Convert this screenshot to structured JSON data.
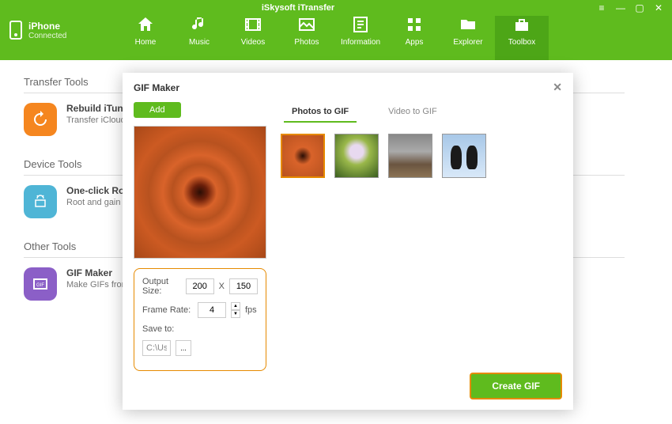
{
  "app_title": "iSkysoft iTransfer",
  "device": {
    "name": "iPhone",
    "status": "Connected"
  },
  "nav": [
    {
      "label": "Home"
    },
    {
      "label": "Music"
    },
    {
      "label": "Videos"
    },
    {
      "label": "Photos"
    },
    {
      "label": "Information"
    },
    {
      "label": "Apps"
    },
    {
      "label": "Explorer"
    },
    {
      "label": "Toolbox"
    }
  ],
  "sections": {
    "transfer": {
      "title": "Transfer Tools",
      "item": {
        "title": "Rebuild iTunes Library",
        "desc": "Transfer iCloud backup data and Playlists to any other device"
      }
    },
    "device": {
      "title": "Device Tools",
      "item": {
        "title": "One-click Root",
        "desc": "Root and gain full control of your Android device"
      }
    },
    "other": {
      "title": "Other Tools",
      "item": {
        "title": "GIF Maker",
        "desc": "Make GIFs from photos or video"
      }
    }
  },
  "modal": {
    "title": "GIF Maker",
    "add_label": "Add",
    "tabs": {
      "photos": "Photos to GIF",
      "video": "Video to GIF"
    },
    "settings": {
      "output_label": "Output Size:",
      "width": "200",
      "sep": "X",
      "height": "150",
      "frame_label": "Frame Rate:",
      "frame_rate": "4",
      "fps": "fps",
      "save_label": "Save to:",
      "save_path": "C:\\Users\\ws\\Pictures\\iSkysoft iTr...",
      "browse": "..."
    },
    "create_label": "Create GIF"
  }
}
